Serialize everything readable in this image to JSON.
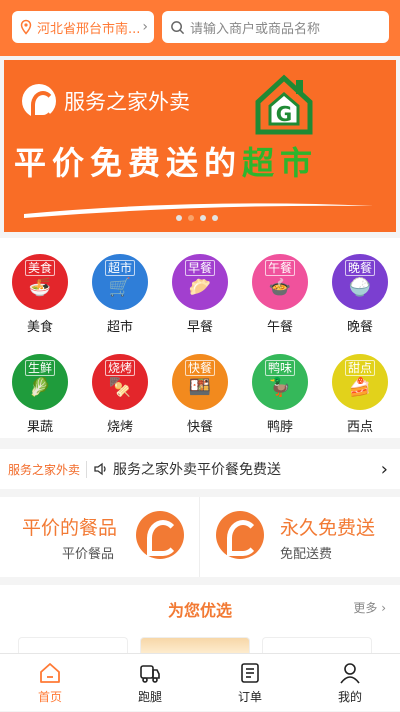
{
  "header": {
    "location": "河北省邢台市南...",
    "search_placeholder": "请输入商户或商品名称"
  },
  "banner": {
    "brand": "服务之家外卖",
    "slogan_main": "平价免费送的",
    "slogan_highlight": "超市",
    "page_count": 4,
    "active_index": 1
  },
  "categories": [
    {
      "label": "美食",
      "tag": "美食",
      "glyph": "🍜",
      "color": "#e3262b",
      "icon": "noodle-bowl-icon"
    },
    {
      "label": "超市",
      "tag": "超市",
      "glyph": "🛒",
      "color": "#2f7ed8",
      "icon": "shopping-cart-icon"
    },
    {
      "label": "早餐",
      "tag": "早餐",
      "glyph": "🥟",
      "color": "#a23fcf",
      "icon": "dumpling-icon"
    },
    {
      "label": "午餐",
      "tag": "午餐",
      "glyph": "🍲",
      "color": "#f0529c",
      "icon": "soup-bowl-icon"
    },
    {
      "label": "晚餐",
      "tag": "晚餐",
      "glyph": "🍚",
      "color": "#7b3fd0",
      "icon": "rice-bowl-icon"
    },
    {
      "label": "果蔬",
      "tag": "生鲜",
      "glyph": "🥬",
      "color": "#1f9c3c",
      "icon": "vegetable-icon"
    },
    {
      "label": "烧烤",
      "tag": "烧烤",
      "glyph": "🍢",
      "color": "#e3262b",
      "icon": "bbq-icon"
    },
    {
      "label": "快餐",
      "tag": "快餐",
      "glyph": "🍱",
      "color": "#f28a1e",
      "icon": "bento-icon"
    },
    {
      "label": "鸭脖",
      "tag": "鸭味",
      "glyph": "🦆",
      "color": "#35b85a",
      "icon": "duck-icon"
    },
    {
      "label": "西点",
      "tag": "甜点",
      "glyph": "🍰",
      "color": "#e2d21b",
      "icon": "cake-icon"
    }
  ],
  "notice": {
    "logo": "服务之家外卖",
    "text": "服务之家外卖平价餐免费送"
  },
  "promos": [
    {
      "title": "平价的餐品",
      "subtitle": "平价餐品"
    },
    {
      "title": "永久免费送",
      "subtitle": "免配送费"
    }
  ],
  "recommend": {
    "title": "为您优选",
    "more": "更多"
  },
  "nav": [
    {
      "label": "首页",
      "icon": "home-icon",
      "active": true
    },
    {
      "label": "跑腿",
      "icon": "delivery-truck-icon",
      "active": false
    },
    {
      "label": "订单",
      "icon": "order-list-icon",
      "active": false
    },
    {
      "label": "我的",
      "icon": "profile-icon",
      "active": false
    }
  ],
  "colors": {
    "brand_orange": "#ff7a35",
    "banner_orange": "#f96d26",
    "highlight_green": "#2db52d"
  }
}
